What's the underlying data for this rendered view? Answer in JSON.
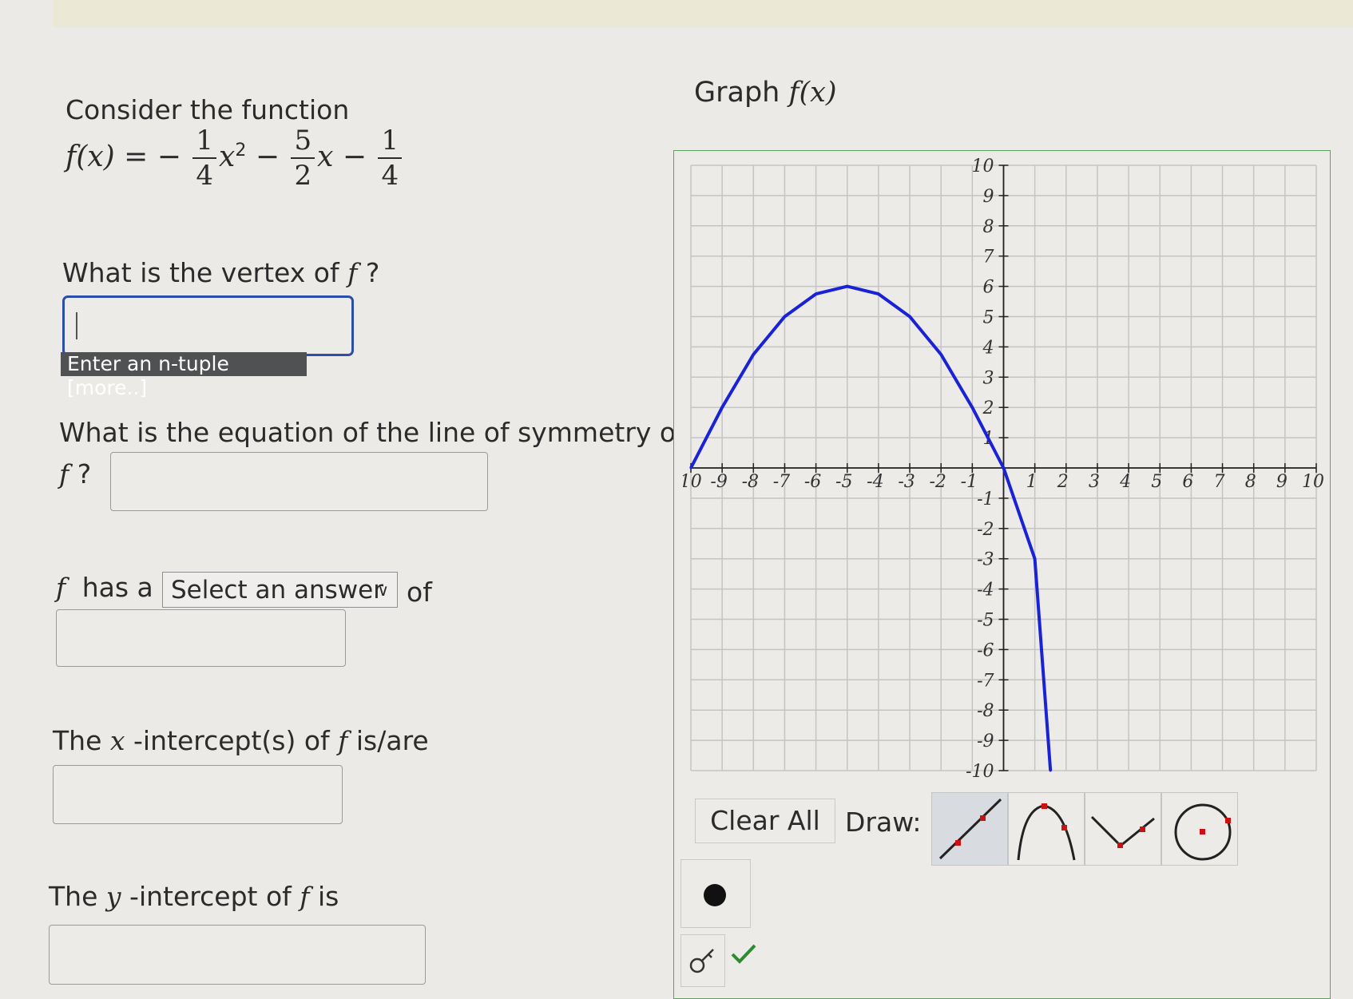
{
  "q_intro": "Consider the function",
  "formula": {
    "lhs": "f(x) =",
    "neg": "−",
    "a_num": "1",
    "a_den": "4",
    "x2": "x",
    "exp": "2",
    "minus1": "−",
    "b_num": "5",
    "b_den": "2",
    "x1": "x",
    "minus2": "−",
    "c_num": "1",
    "c_den": "4"
  },
  "q_vertex": {
    "text": "What is the vertex of",
    "var": "f",
    "mark": "?",
    "value": "",
    "hint": "Enter an n-tuple [more..]"
  },
  "q_symmetry": {
    "text": "What is the equation of the line of symmetry of",
    "var": "f",
    "mark": "?",
    "value": ""
  },
  "q_maxmin": {
    "var": "f",
    "has_a": "has a",
    "select_value": "Select an answer",
    "of": "of",
    "value": ""
  },
  "q_xint": {
    "pre": "The",
    "var": "x",
    "mid": "-intercept(s) of",
    "fvar": "f",
    "post": "is/are",
    "value": ""
  },
  "q_yint": {
    "pre": "The",
    "var": "y",
    "mid": "-intercept of",
    "fvar": "f",
    "post": "is",
    "value": ""
  },
  "graph_title": {
    "text": "Graph",
    "fx": "f(x)"
  },
  "toolbar": {
    "clear_all": "Clear All",
    "draw_label": "Draw:",
    "tools": [
      "line-tool",
      "parabola-down-tool",
      "absolute-value-tool",
      "circle-tool"
    ],
    "selected_tool": "line-tool"
  },
  "colors": {
    "curve": "#1a22d6",
    "grid": "#c4c4c4",
    "frame": "#5fa25f",
    "accent_red": "#cc1111",
    "check": "#2e8b2e",
    "focus": "#2b4fa6"
  },
  "chart_data": {
    "type": "line",
    "xlim": [
      -10,
      10
    ],
    "ylim": [
      -10,
      10
    ],
    "grid": true,
    "x_ticks": [
      "-10",
      "-9",
      "-8",
      "-7",
      "-6",
      "-5",
      "-4",
      "-3",
      "-2",
      "-1",
      "1",
      "2",
      "3",
      "4",
      "5",
      "6",
      "7",
      "8",
      "9",
      "10"
    ],
    "y_ticks": [
      "10",
      "9",
      "8",
      "7",
      "6",
      "5",
      "4",
      "3",
      "2",
      "1",
      "-1",
      "-2",
      "-3",
      "-4",
      "-5",
      "-6",
      "-7",
      "-8",
      "-9",
      "-10"
    ],
    "series": [
      {
        "x": [
          -10,
          -9,
          -8,
          -7,
          -6,
          -5,
          -4,
          -3,
          -2,
          -1,
          0,
          1,
          1.5
        ],
        "y": [
          0,
          2,
          3.75,
          5,
          5.75,
          6,
          5.75,
          5,
          3.75,
          2,
          0,
          -3,
          -10
        ]
      }
    ]
  }
}
